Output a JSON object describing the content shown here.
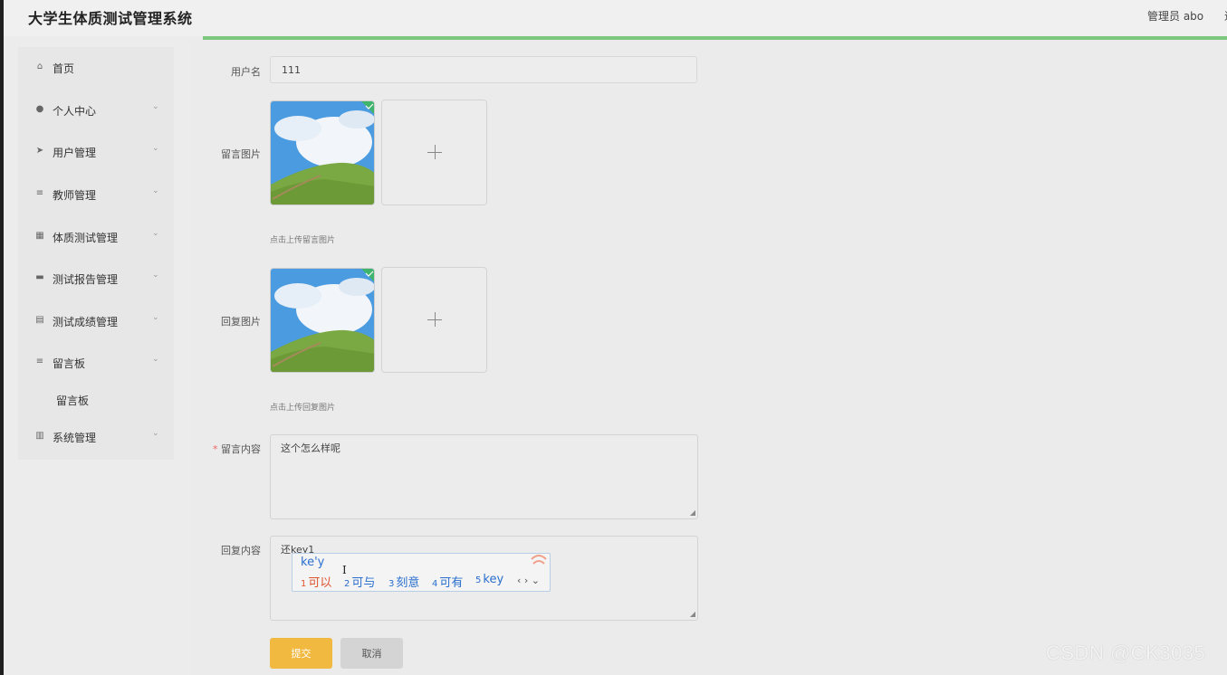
{
  "header": {
    "app_title": "大学生体质测试管理系统",
    "user_label": "管理员 abo",
    "user_extra": "退"
  },
  "sidebar": {
    "items": [
      {
        "label": "首页",
        "icon": "home-icon"
      },
      {
        "label": "个人中心",
        "icon": "user-icon"
      },
      {
        "label": "用户管理",
        "icon": "send-icon"
      },
      {
        "label": "教师管理",
        "icon": "list-icon"
      },
      {
        "label": "体质测试管理",
        "icon": "grid-icon"
      },
      {
        "label": "测试报告管理",
        "icon": "monitor-icon"
      },
      {
        "label": "测试成绩管理",
        "icon": "document-icon"
      },
      {
        "label": "留言板",
        "icon": "list-icon"
      },
      {
        "label": "系统管理",
        "icon": "chart-icon"
      }
    ],
    "sub_item": "留言板"
  },
  "form": {
    "username_label": "用户名",
    "username_value": "111",
    "message_image_label": "留言图片",
    "message_image_hint": "点击上传留言图片",
    "reply_image_label": "回复图片",
    "reply_image_hint": "点击上传回复图片",
    "content_required": "*",
    "content_label": "留言内容",
    "content_value": "这个怎么样呢",
    "reply_label": "回复内容",
    "reply_value": "还key1",
    "submit_label": "提交",
    "cancel_label": "取消"
  },
  "ime": {
    "composition": "ke'y",
    "candidates": [
      {
        "num": "1",
        "text": "可以",
        "color": "#e0532f"
      },
      {
        "num": "2",
        "text": "可与",
        "color": "#2a6fcf"
      },
      {
        "num": "3",
        "text": "刻意",
        "color": "#2a6fcf"
      },
      {
        "num": "4",
        "text": "可有",
        "color": "#2a6fcf"
      },
      {
        "num": "5",
        "text": "key",
        "color": "#2a6fcf"
      }
    ],
    "nav": "‹ › ⌄"
  },
  "watermark": "CSDN @CK3035",
  "colors": {
    "accent_green": "#7ec77e",
    "submit": "#f1b93f",
    "cancel": "#d4d4d4"
  }
}
